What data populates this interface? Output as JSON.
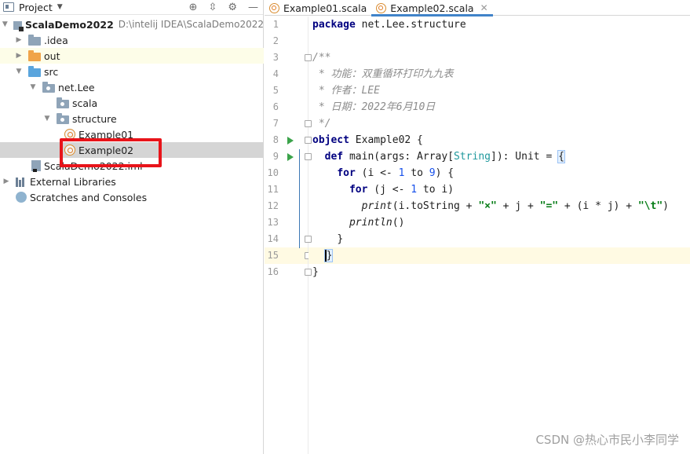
{
  "project_panel": {
    "title": "Project",
    "tree": [
      {
        "name": "ScalaDemo2022",
        "path": "D:\\intelij IDEA\\ScalaDemo2022"
      },
      {
        "name": ".idea"
      },
      {
        "name": "out"
      },
      {
        "name": "src"
      },
      {
        "name": "net.Lee"
      },
      {
        "name": "scala"
      },
      {
        "name": "structure"
      },
      {
        "name": "Example01"
      },
      {
        "name": "Example02"
      },
      {
        "name": "ScalaDemo2022.iml"
      },
      {
        "name": "External Libraries"
      },
      {
        "name": "Scratches and Consoles"
      }
    ]
  },
  "tabs": [
    {
      "label": "Example01.scala"
    },
    {
      "label": "Example02.scala"
    }
  ],
  "editor": {
    "line_numbers": [
      "1",
      "2",
      "3",
      "4",
      "5",
      "6",
      "7",
      "8",
      "9",
      "10",
      "11",
      "12",
      "13",
      "14",
      "15",
      "16"
    ],
    "lines": {
      "l1_kw": "package",
      "l1_rest": " net.Lee.structure",
      "l3": "/**",
      "l4": " * 功能：双重循环打印九九表",
      "l5": " * 作者：LEE",
      "l6": " * 日期：2022年6月10日",
      "l7": " */",
      "l8_kw": "object",
      "l8_rest": " Example02 {",
      "l9_kw": "def",
      "l9_a": " main(args: Array[",
      "l9_type": "String",
      "l9_b": "]): Unit = ",
      "l9_brace": "{",
      "l10_kw": "for",
      "l10_a": " (i <- ",
      "l10_n1": "1",
      "l10_b": " to ",
      "l10_n2": "9",
      "l10_c": ") {",
      "l11_kw": "for",
      "l11_a": " (j <- ",
      "l11_n1": "1",
      "l11_b": " to i)",
      "l12_fn": "print",
      "l12_a": "(i.toString + ",
      "l12_s1": "\"×\"",
      "l12_b": " + j + ",
      "l12_s2": "\"=\"",
      "l12_c": " + (i * j) + ",
      "l12_s3": "\"\\t\"",
      "l12_d": ")",
      "l13_fn": "println",
      "l13_a": "()",
      "l14": "}",
      "l15": "}",
      "l16": "}"
    }
  },
  "watermark": "CSDN @热心市民小李同学"
}
